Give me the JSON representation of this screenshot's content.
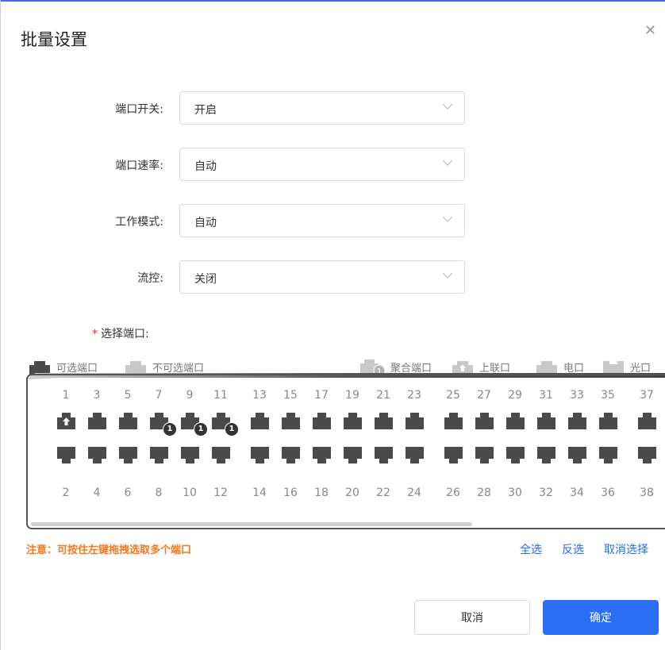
{
  "dialog": {
    "title": "批量设置"
  },
  "form": {
    "fields": [
      {
        "label": "端口开关:",
        "value": "开启"
      },
      {
        "label": "端口速率:",
        "value": "自动"
      },
      {
        "label": "工作模式:",
        "value": "自动"
      },
      {
        "label": "流控:",
        "value": "关闭"
      }
    ],
    "port_select_label": "选择端口:",
    "required_mark": "*"
  },
  "legend": {
    "selectable": "可选端口",
    "unselectable": "不可选端口",
    "aggregate": "聚合端口",
    "uplink": "上联口",
    "electrical": "电口",
    "optical": "光口"
  },
  "ports": {
    "top_numbers": [
      "1",
      "3",
      "5",
      "7",
      "9",
      "11",
      "13",
      "15",
      "17",
      "19",
      "21",
      "23",
      "25",
      "27",
      "29",
      "31",
      "33",
      "35",
      "37"
    ],
    "bottom_numbers": [
      "2",
      "4",
      "6",
      "8",
      "10",
      "12",
      "14",
      "16",
      "18",
      "20",
      "22",
      "24",
      "26",
      "28",
      "30",
      "32",
      "34",
      "36",
      "38"
    ],
    "uplink_port": "1",
    "aggregate_badge": "1",
    "aggregate_ports": [
      "7",
      "9",
      "11"
    ]
  },
  "hint": "注意：可按住左键拖拽选取多个端口",
  "actions": {
    "select_all": "全选",
    "invert": "反选",
    "deselect": "取消选择"
  },
  "buttons": {
    "cancel": "取消",
    "confirm": "确定"
  },
  "colors": {
    "primary": "#2a6ef5",
    "warning": "#f5781e",
    "port_dark": "#4a4a4a",
    "port_light": "#c8c8c8"
  }
}
